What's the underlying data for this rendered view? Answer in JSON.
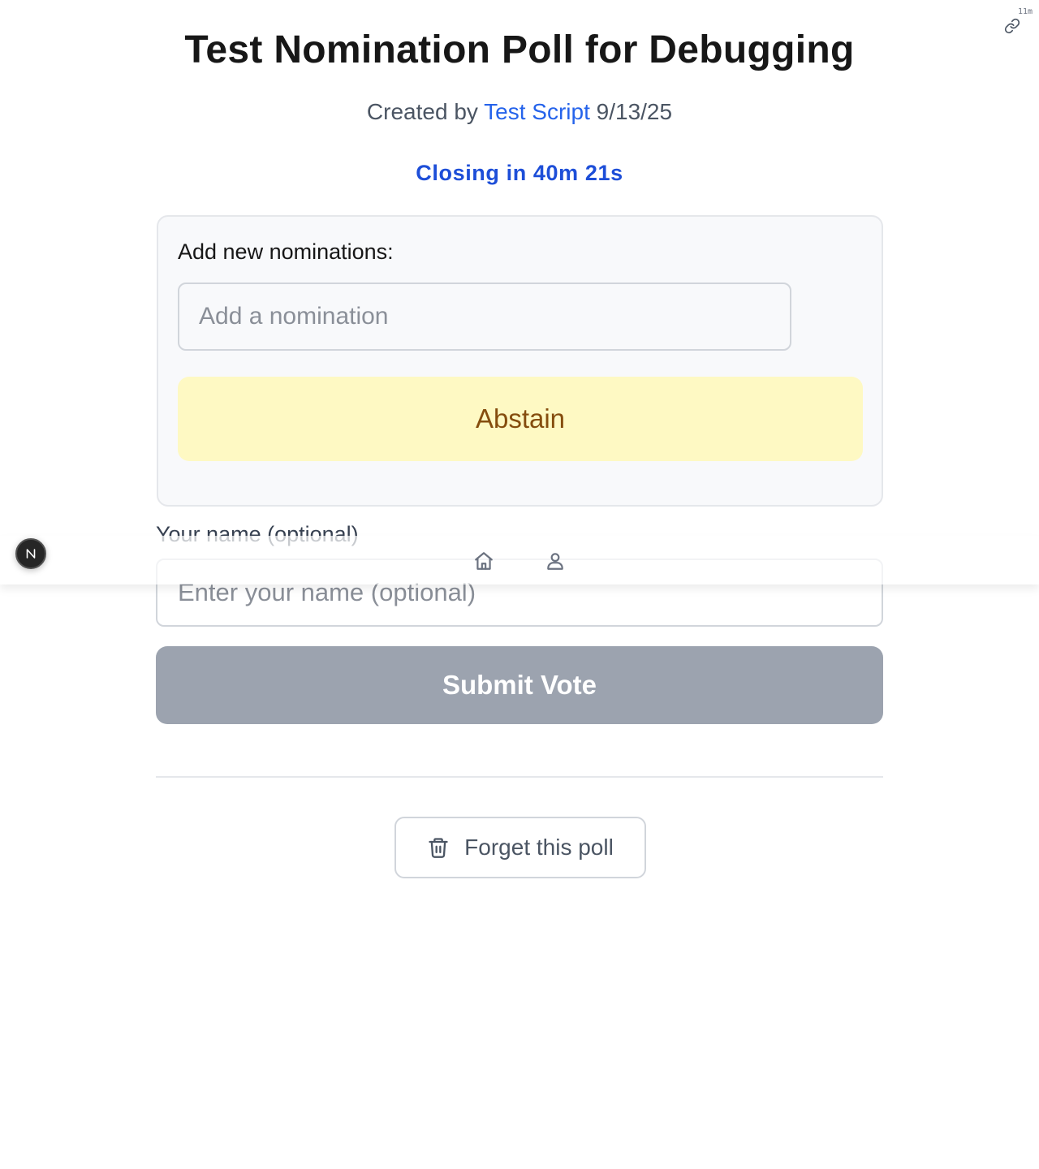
{
  "header": {
    "age": "11m",
    "share_icon": "link-icon"
  },
  "poll": {
    "title": "Test Nomination Poll for Debugging",
    "created_prefix": "Created by",
    "author": "Test Script",
    "date": "9/13/25",
    "closing": "Closing in 40m 21s"
  },
  "nominations": {
    "heading": "Add new nominations:",
    "input_placeholder": "Add a nomination",
    "abstain_label": "Abstain"
  },
  "voter": {
    "name_label": "Your name (optional)",
    "name_placeholder": "Enter your name (optional)"
  },
  "actions": {
    "submit_label": "Submit Vote",
    "forget_label": "Forget this poll",
    "forget_icon": "trash-icon"
  },
  "nav": {
    "home_icon": "home-icon",
    "user_icon": "user-icon"
  },
  "dev_badge": {
    "letter": "N"
  },
  "colors": {
    "accent": "#2563eb",
    "closing": "#1d4ed8",
    "abstain_bg": "#fef9c3",
    "abstain_text": "#854d0e",
    "submit_disabled": "#9ca3af"
  }
}
